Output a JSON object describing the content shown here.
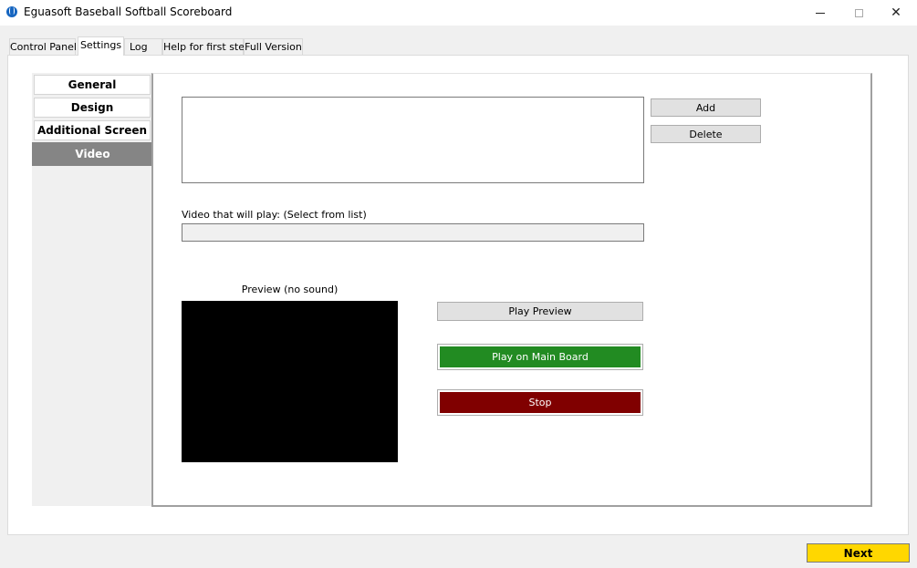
{
  "window": {
    "title": "Eguasoft Baseball Softball Scoreboard",
    "app_icon": "baseball-icon",
    "controls": {
      "minimize": "—",
      "maximize": "☐",
      "close": "✕"
    }
  },
  "tabs": [
    {
      "label": "Control Panel",
      "active": false
    },
    {
      "label": "Settings",
      "active": true
    },
    {
      "label": "Log",
      "active": false
    },
    {
      "label": "Help for first step",
      "active": false
    },
    {
      "label": "Full Version",
      "active": false
    }
  ],
  "settings_nav": [
    {
      "label": "General",
      "active": false
    },
    {
      "label": "Design",
      "active": false
    },
    {
      "label": "Additional Screen",
      "active": false
    },
    {
      "label": "Video",
      "active": true
    }
  ],
  "video": {
    "list_items": [],
    "add_label": "Add",
    "delete_label": "Delete",
    "selected_label": "Video that will play: (Select from list)",
    "selected_value": "",
    "preview_label": "Preview (no sound)",
    "play_preview_label": "Play Preview",
    "play_main_label": "Play on Main Board",
    "stop_label": "Stop"
  },
  "footer": {
    "next_label": "Next"
  },
  "colors": {
    "play_main": "#228b22",
    "stop": "#800000",
    "next": "#ffd700",
    "active_nav": "#858585"
  }
}
